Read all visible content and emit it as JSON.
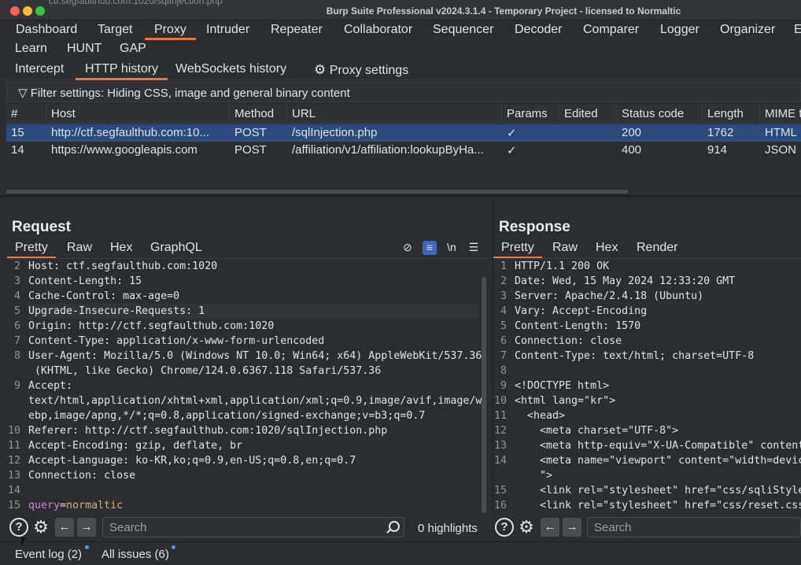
{
  "window": {
    "title": "Burp Suite Professional v2024.3.1.4 - Temporary Project - licensed to Normaltic",
    "url_ghost": "ctf.segfaulthub.com:1020/sqlInjection.php"
  },
  "main_tabs": [
    "Dashboard",
    "Target",
    "Proxy",
    "Intruder",
    "Repeater",
    "Collaborator",
    "Sequencer",
    "Decoder",
    "Comparer",
    "Logger",
    "Organizer",
    "E",
    "Learn",
    "HUNT",
    "GAP"
  ],
  "sub_tabs": {
    "intercept": "Intercept",
    "history": "HTTP history",
    "websockets": "WebSockets history",
    "settings": "Proxy settings"
  },
  "filter": "Filter settings: Hiding CSS, image and general binary content",
  "table": {
    "headers": [
      "#",
      "Host",
      "Method",
      "URL",
      "Params",
      "Edited",
      "Status code",
      "Length",
      "MIME ty"
    ],
    "rows": [
      {
        "num": "15",
        "host": "http://ctf.segfaulthub.com:10...",
        "method": "POST",
        "url": "/sqlInjection.php",
        "params": "✓",
        "edited": "",
        "status": "200",
        "length": "1762",
        "mime": "HTML"
      },
      {
        "num": "14",
        "host": "https://www.googleapis.com",
        "method": "POST",
        "url": "/affiliation/v1/affiliation:lookupByHa...",
        "params": "✓",
        "edited": "",
        "status": "400",
        "length": "914",
        "mime": "JSON"
      }
    ]
  },
  "request": {
    "title": "Request",
    "tabs": [
      "Pretty",
      "Raw",
      "Hex",
      "GraphQL"
    ],
    "tools": {
      "newline": "\\n"
    },
    "lines": [
      {
        "n": "2",
        "text": "Host: ctf.segfaulthub.com:1020"
      },
      {
        "n": "3",
        "text": "Content-Length: 15"
      },
      {
        "n": "4",
        "text": "Cache-Control: max-age=0"
      },
      {
        "n": "5",
        "text": "Upgrade-Insecure-Requests: 1"
      },
      {
        "n": "6",
        "text": "Origin: http://ctf.segfaulthub.com:1020"
      },
      {
        "n": "7",
        "text": "Content-Type: application/x-www-form-urlencoded"
      },
      {
        "n": "8",
        "text": "User-Agent: Mozilla/5.0 (Windows NT 10.0; Win64; x64) AppleWebKit/537.36"
      },
      {
        "n": "",
        "text": " (KHTML, like Gecko) Chrome/124.0.6367.118 Safari/537.36"
      },
      {
        "n": "9",
        "text": "Accept:"
      },
      {
        "n": "",
        "text": "text/html,application/xhtml+xml,application/xml;q=0.9,image/avif,image/w"
      },
      {
        "n": "",
        "text": "ebp,image/apng,*/*;q=0.8,application/signed-exchange;v=b3;q=0.7"
      },
      {
        "n": "10",
        "text": "Referer: http://ctf.segfaulthub.com:1020/sqlInjection.php"
      },
      {
        "n": "11",
        "text": "Accept-Encoding: gzip, deflate, br"
      },
      {
        "n": "12",
        "text": "Accept-Language: ko-KR,ko;q=0.9,en-US;q=0.8,en;q=0.7"
      },
      {
        "n": "13",
        "text": "Connection: close"
      },
      {
        "n": "14",
        "text": ""
      },
      {
        "n": "15",
        "text": "query=normaltic"
      }
    ],
    "search_placeholder": "Search",
    "highlights": "0 highlights"
  },
  "response": {
    "title": "Response",
    "tabs": [
      "Pretty",
      "Raw",
      "Hex",
      "Render"
    ],
    "lines": [
      {
        "n": "1",
        "text": "HTTP/1.1 200 OK"
      },
      {
        "n": "2",
        "text": "Date: Wed, 15 May 2024 12:33:20 GMT"
      },
      {
        "n": "3",
        "text": "Server: Apache/2.4.18 (Ubuntu)"
      },
      {
        "n": "4",
        "text": "Vary: Accept-Encoding"
      },
      {
        "n": "5",
        "text": "Content-Length: 1570"
      },
      {
        "n": "6",
        "text": "Connection: close"
      },
      {
        "n": "7",
        "text": "Content-Type: text/html; charset=UTF-8"
      },
      {
        "n": "8",
        "text": ""
      },
      {
        "n": "9",
        "text": "<!DOCTYPE html>"
      },
      {
        "n": "10",
        "text": "<html lang=\"kr\">"
      },
      {
        "n": "11",
        "text": "  <head>"
      },
      {
        "n": "12",
        "text": "    <meta charset=\"UTF-8\">"
      },
      {
        "n": "13",
        "text": "    <meta http-equiv=\"X-UA-Compatible\" content"
      },
      {
        "n": "14",
        "text": "    <meta name=\"viewport\" content=\"width=devic"
      },
      {
        "n": "",
        "text": "    \">"
      },
      {
        "n": "15",
        "text": "    <link rel=\"stylesheet\" href=\"css/sqliStyle"
      },
      {
        "n": "16",
        "text": "    <link rel=\"stylesheet\" href=\"css/reset.css"
      }
    ],
    "search_placeholder": "Search"
  },
  "status_bar": {
    "event_log": "Event log (2)",
    "all_issues": "All issues (6)"
  },
  "colors": {
    "accent": "#e8783a",
    "selected_row": "#2b4a7d",
    "bg": "#2b2d30"
  }
}
